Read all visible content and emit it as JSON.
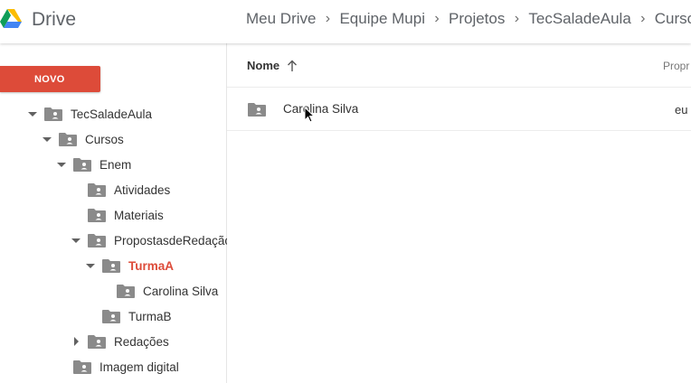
{
  "header": {
    "app_title": "Drive",
    "logo_icon": "google-drive-logo",
    "breadcrumb": [
      "Meu Drive",
      "Equipe Mupi",
      "Projetos",
      "TecSaladeAula",
      "Cursos"
    ]
  },
  "sidebar": {
    "new_button": "NOVO",
    "tree": [
      {
        "label": "TecSaladeAula",
        "expanded": true,
        "icon": "shared-folder-icon"
      },
      {
        "label": "Cursos",
        "expanded": true,
        "icon": "shared-folder-icon"
      },
      {
        "label": "Enem",
        "expanded": true,
        "icon": "shared-folder-icon"
      },
      {
        "label": "Atividades",
        "icon": "shared-folder-icon"
      },
      {
        "label": "Materiais",
        "icon": "shared-folder-icon"
      },
      {
        "label": "PropostasdeRedação",
        "expanded": true,
        "icon": "shared-folder-icon"
      },
      {
        "label": "TurmaA",
        "expanded": true,
        "active": true,
        "icon": "shared-folder-icon"
      },
      {
        "label": "Carolina Silva",
        "icon": "shared-folder-icon"
      },
      {
        "label": "TurmaB",
        "icon": "shared-folder-icon"
      },
      {
        "label": "Redações",
        "expanded": false,
        "icon": "shared-folder-icon"
      },
      {
        "label": "Imagem digital",
        "icon": "shared-folder-icon"
      }
    ]
  },
  "main": {
    "columns": {
      "name": "Nome",
      "owner": "Propr"
    },
    "files": [
      {
        "name": "Carolina Silva",
        "owner": "eu",
        "icon": "shared-folder-icon"
      }
    ]
  },
  "colors": {
    "accent": "#dd4b39",
    "folder": "#8a8a8a",
    "header_text": "#5f6368"
  }
}
